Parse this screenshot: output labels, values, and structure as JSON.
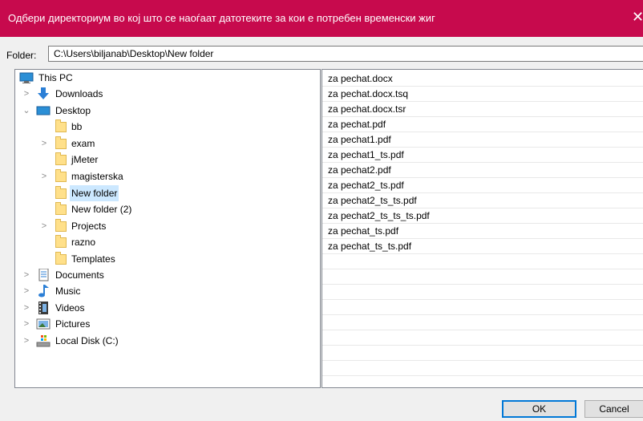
{
  "window": {
    "title": "Одбери директориум во кој што се наоѓаат датотеките за кои е потребен временски жиг",
    "close_glyph": "✕"
  },
  "folder": {
    "label": "Folder:",
    "value": "C:\\Users\\biljanab\\Desktop\\New folder"
  },
  "tree": {
    "this_pc": "This PC",
    "downloads": "Downloads",
    "desktop": "Desktop",
    "folders": [
      {
        "label": "bb",
        "expandable": false
      },
      {
        "label": "exam",
        "expandable": true
      },
      {
        "label": "jMeter",
        "expandable": false
      },
      {
        "label": "magisterska",
        "expandable": true
      },
      {
        "label": "New folder",
        "expandable": false,
        "selected": true
      },
      {
        "label": "New folder (2)",
        "expandable": false
      },
      {
        "label": "Projects",
        "expandable": true
      },
      {
        "label": "razno",
        "expandable": false
      },
      {
        "label": "Templates",
        "expandable": false
      }
    ],
    "documents": "Documents",
    "music": "Music",
    "videos": "Videos",
    "pictures": "Pictures",
    "local_disk": "Local Disk (C:)"
  },
  "files": [
    "za pechat.docx",
    "za pechat.docx.tsq",
    "za pechat.docx.tsr",
    "za pechat.pdf",
    "za pechat1.pdf",
    "za pechat1_ts.pdf",
    "za pechat2.pdf",
    "za pechat2_ts.pdf",
    "za pechat2_ts_ts.pdf",
    "za pechat2_ts_ts_ts.pdf",
    "za pechat_ts.pdf",
    "za pechat_ts_ts.pdf"
  ],
  "buttons": {
    "ok": "OK",
    "cancel": "Cancel"
  },
  "colors": {
    "titlebar": "#c70a4d",
    "selection": "#cce8ff",
    "folder": "#ffe08a"
  }
}
